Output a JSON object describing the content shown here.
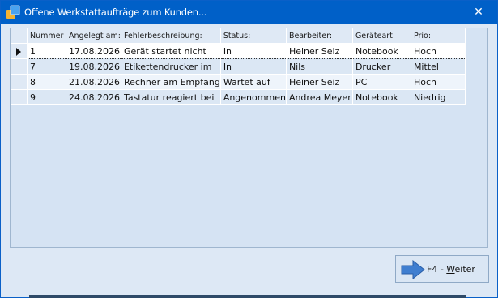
{
  "window": {
    "title": "Offene Werkstattaufträge zum Kunden...",
    "close_glyph": "✕"
  },
  "grid": {
    "columns": [
      "Nummer",
      "Angelegt am:",
      "Fehlerbeschreibung:",
      "Status:",
      "Bearbeiter:",
      "Geräteart:",
      "Prio:"
    ],
    "selected_row": 0,
    "rows": [
      {
        "nummer": "1",
        "angelegt": "17.08.2026",
        "fehler": "Gerät startet nicht",
        "status": "In",
        "bearbeiter": "Heiner Seiz",
        "geraet": "Notebook",
        "prio": "Hoch"
      },
      {
        "nummer": "7",
        "angelegt": "19.08.2026",
        "fehler": "Etikettendrucker im",
        "status": "In",
        "bearbeiter": "Nils",
        "geraet": "Drucker",
        "prio": "Mittel"
      },
      {
        "nummer": "8",
        "angelegt": "21.08.2026",
        "fehler": "Rechner am Empfang",
        "status": "Wartet auf",
        "bearbeiter": "Heiner Seiz",
        "geraet": "PC",
        "prio": "Hoch"
      },
      {
        "nummer": "9",
        "angelegt": "24.08.2026",
        "fehler": "Tastatur reagiert bei",
        "status": "Angenommen",
        "bearbeiter": "Andrea Meyer",
        "geraet": "Notebook",
        "prio": "Niedrig"
      }
    ]
  },
  "footer": {
    "next_button": {
      "prefix": "F4 - ",
      "mnemonic": "W",
      "rest": "eiter"
    }
  },
  "colors": {
    "titlebar": "#0060c8",
    "window_bg": "#dde8f5",
    "selected_row": "#ffffff",
    "arrow": "#3f7ed0"
  },
  "icons": {
    "app": "app-icon",
    "close": "close-icon",
    "row_pointer": "row-pointer-icon",
    "next": "arrow-right-icon"
  }
}
